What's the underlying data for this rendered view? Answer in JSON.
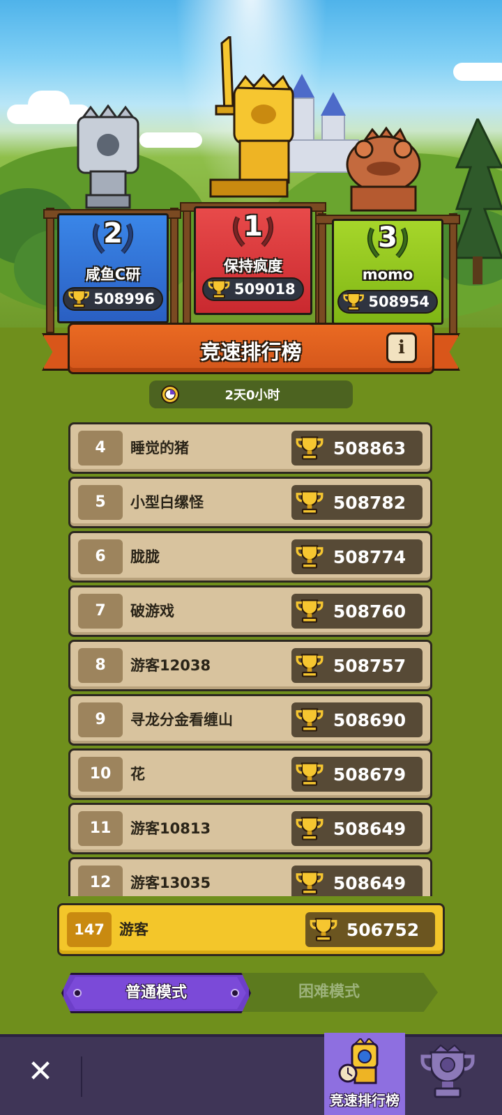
{
  "podium": [
    {
      "place": "1",
      "name": "保持疯度",
      "score": "509018"
    },
    {
      "place": "2",
      "name": "咸鱼C研",
      "score": "508996"
    },
    {
      "place": "3",
      "name": "momo",
      "score": "508954"
    }
  ],
  "board": {
    "title": "竞速排行榜",
    "info_icon": "i",
    "timer": "2天0小时"
  },
  "rows": [
    {
      "rank": "4",
      "name": "睡觉的猪",
      "score": "508863"
    },
    {
      "rank": "5",
      "name": "小型白缧怪",
      "score": "508782"
    },
    {
      "rank": "6",
      "name": "胧胧",
      "score": "508774"
    },
    {
      "rank": "7",
      "name": "破游戏",
      "score": "508760"
    },
    {
      "rank": "8",
      "name": "游客12038",
      "score": "508757"
    },
    {
      "rank": "9",
      "name": "寻龙分金看缠山",
      "score": "508690"
    },
    {
      "rank": "10",
      "name": "花",
      "score": "508679"
    },
    {
      "rank": "11",
      "name": "游客10813",
      "score": "508649"
    },
    {
      "rank": "12",
      "name": "游客13035",
      "score": "508649"
    }
  ],
  "me": {
    "rank": "147",
    "name": "游客",
    "score": "506752"
  },
  "modes": {
    "normal": "普通模式",
    "hard": "困难模式",
    "selected": "normal"
  },
  "nav": {
    "close": "✕",
    "active_tab": "竞速排行榜"
  },
  "icons": [
    "trophy-icon",
    "laurel-icon",
    "clock-icon",
    "info-icon",
    "close-icon",
    "ranking-tab-icon",
    "trophy-tab-icon"
  ],
  "colors": {
    "first": "#d9323a",
    "second": "#2f6fd8",
    "third": "#8fc41a",
    "accent": "#ea6a22",
    "me": "#f3c62a",
    "mode": "#7b4ad8"
  }
}
